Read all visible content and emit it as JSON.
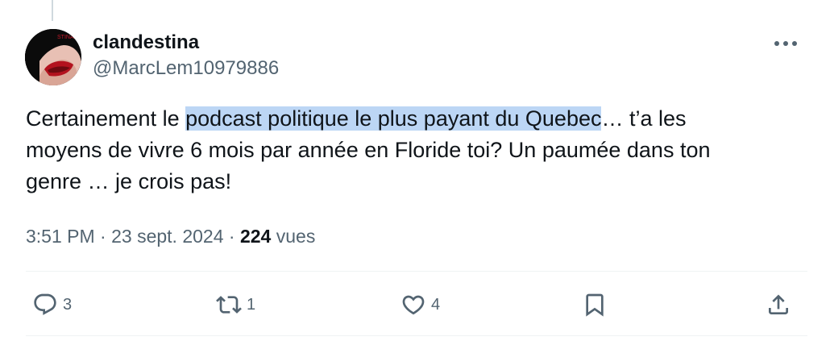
{
  "tweet": {
    "author": {
      "display_name": "clandestina",
      "handle": "@MarcLem10979886"
    },
    "text": {
      "before": "Certainement le ",
      "highlighted": "podcast politique le plus payant du Quebec",
      "after": "… t’a les moyens de vivre 6 mois par année en Floride toi?  Un paumée dans ton genre … je crois pas!"
    },
    "meta": {
      "time": "3:51 PM",
      "separator": "·",
      "date": "23 sept. 2024",
      "views_count": "224",
      "views_label": "vues"
    },
    "actions": {
      "reply_count": "3",
      "retweet_count": "1",
      "like_count": "4"
    }
  },
  "colors": {
    "text": "#0f1419",
    "secondary": "#536471",
    "highlight": "#bcd6f5",
    "divider": "#eff3f4"
  }
}
